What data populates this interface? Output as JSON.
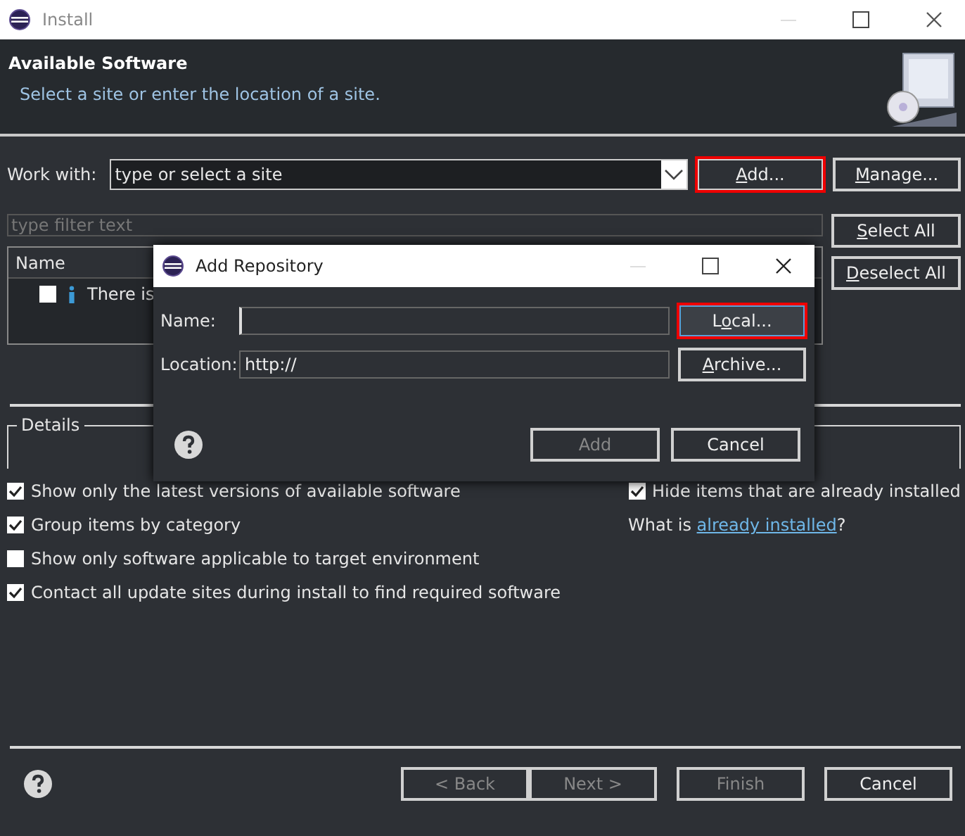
{
  "window": {
    "title": "Install"
  },
  "header": {
    "title": "Available Software",
    "subtitle": "Select a site or enter the location of a site."
  },
  "work_with": {
    "label": "Work with:",
    "placeholder": "type or select a site"
  },
  "site_buttons": [
    {
      "label": [
        {
          "text": "A",
          "underlined": true
        },
        {
          "text": "dd...",
          "underlined": false
        }
      ],
      "highlighted": true
    },
    {
      "label": [
        {
          "text": "M",
          "underlined": true
        },
        {
          "text": "anage...",
          "underlined": false
        }
      ],
      "highlighted": false
    }
  ],
  "filter": {
    "placeholder": "type filter text"
  },
  "table": {
    "columns": [
      "Name"
    ],
    "rows": [
      {
        "text": "There is",
        "checked": false
      }
    ]
  },
  "selection_buttons": [
    {
      "label": [
        {
          "text": "S",
          "underlined": true
        },
        {
          "text": "elect All",
          "underlined": false
        }
      ]
    },
    {
      "label": [
        {
          "text": "D",
          "underlined": true
        },
        {
          "text": "eselect All",
          "underlined": false
        }
      ]
    }
  ],
  "details": {
    "label": "Details"
  },
  "options": [
    {
      "label": "Show only the latest versions of available software",
      "checked": true
    },
    {
      "label": "Group items by category",
      "checked": true
    },
    {
      "label": "Show only software applicable to target environment",
      "checked": false
    },
    {
      "label": "Contact all update sites during install to find required software",
      "checked": true
    }
  ],
  "hide_installed": {
    "label": "Hide items that are already installed",
    "checked": true
  },
  "installed_link": {
    "prefix": "What is ",
    "link": "already installed",
    "suffix": "?"
  },
  "footer_buttons": [
    {
      "label": "< Back",
      "disabled": true
    },
    {
      "label": "Next >",
      "disabled": true
    },
    {
      "label": "Finish",
      "disabled": true
    },
    {
      "label": "Cancel",
      "disabled": false
    }
  ],
  "dialog": {
    "title": "Add Repository",
    "fields": [
      {
        "label": "Name:"
      },
      {
        "label": "Location:",
        "value": "http://"
      }
    ],
    "side_buttons": [
      {
        "label": [
          {
            "text": "L",
            "underlined": false
          },
          {
            "text": "o",
            "underlined": true
          },
          {
            "text": "cal...",
            "underlined": false
          }
        ],
        "highlighted": true
      },
      {
        "label": [
          {
            "text": "A",
            "underlined": true
          },
          {
            "text": "rchive...",
            "underlined": false
          }
        ],
        "highlighted": false
      }
    ],
    "buttons": [
      {
        "label": "Add",
        "disabled": true
      },
      {
        "label": "Cancel",
        "disabled": false
      }
    ]
  }
}
